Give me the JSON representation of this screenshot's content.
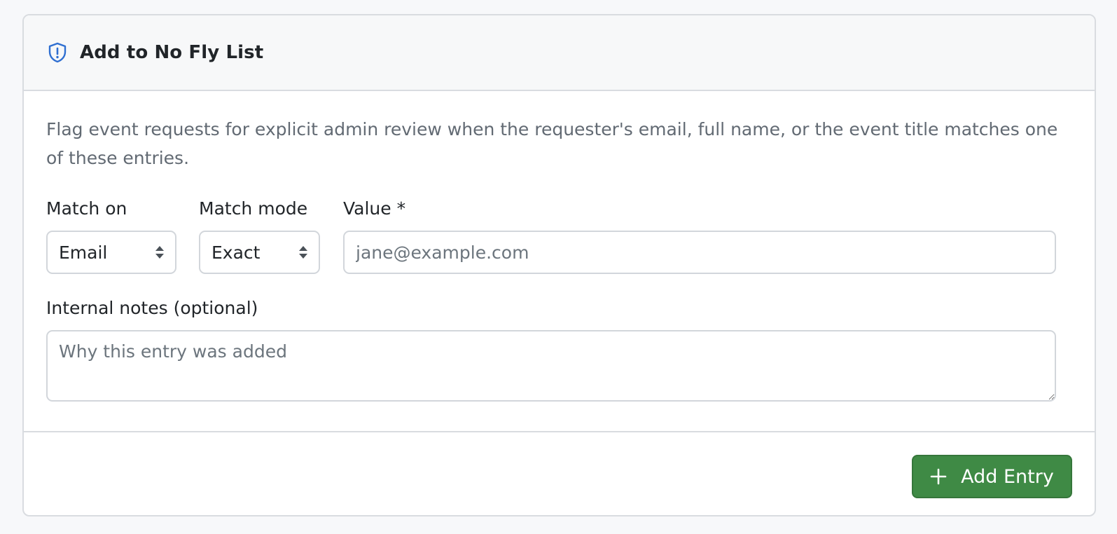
{
  "header": {
    "icon": "shield-exclamation-icon",
    "title": "Add to No Fly List",
    "accent_color": "#2f6fd1"
  },
  "description": "Flag event requests for explicit admin review when the requester's email, full name, or the event title matches one of these entries.",
  "form": {
    "match_on": {
      "label": "Match on",
      "value": "Email"
    },
    "match_mode": {
      "label": "Match mode",
      "value": "Exact"
    },
    "value": {
      "label": "Value *",
      "placeholder": "jane@example.com"
    },
    "notes": {
      "label": "Internal notes (optional)",
      "placeholder": "Why this entry was added"
    }
  },
  "footer": {
    "add_button_label": "Add Entry",
    "add_button_icon": "plus-icon",
    "button_color": "#3f8a45"
  }
}
